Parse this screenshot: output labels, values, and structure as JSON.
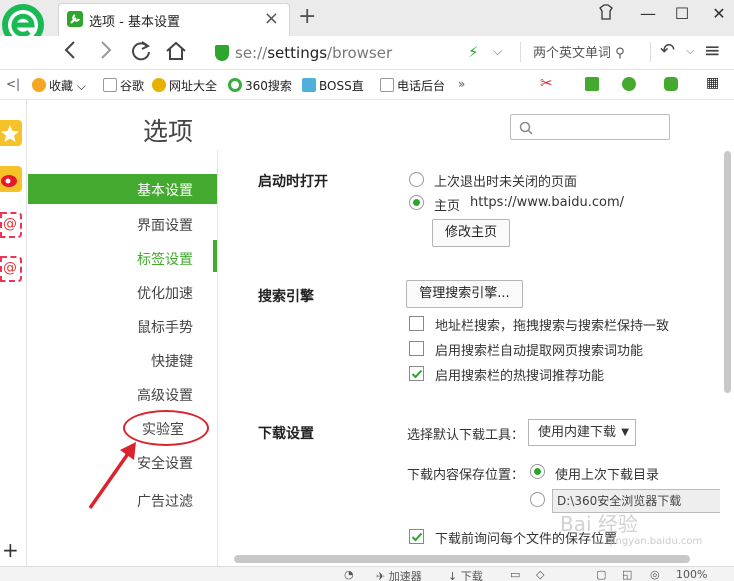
{
  "browser": {
    "tab_title": "选项 - 基本设置",
    "tab_close": "×",
    "new_tab": "+",
    "url_prefix": "se://",
    "url_host": "settings",
    "url_path": "/browser",
    "search_hint": "两个英文单词",
    "window_buttons": [
      "—",
      "☐",
      "✕"
    ]
  },
  "bookmarks": [
    {
      "label": "收藏",
      "color": "#f5a623"
    },
    {
      "label": "谷歌",
      "color": "#9e9e9e"
    },
    {
      "label": "网址大全",
      "color": "#e7b100"
    },
    {
      "label": "360搜索",
      "color": "#3bab3b"
    },
    {
      "label": "BOSS直",
      "color": "#4fb0d9"
    },
    {
      "label": "电话后台",
      "color": "#9e9e9e"
    }
  ],
  "bookmarks_more": "»",
  "settings": {
    "title": "选项",
    "search_placeholder": ""
  },
  "nav": {
    "items": [
      {
        "label": "基本设置",
        "state": "active"
      },
      {
        "label": "界面设置",
        "state": "normal"
      },
      {
        "label": "标签设置",
        "state": "highlight"
      },
      {
        "label": "优化加速",
        "state": "normal"
      },
      {
        "label": "鼠标手势",
        "state": "normal"
      },
      {
        "label": "快捷键",
        "state": "normal"
      },
      {
        "label": "高级设置",
        "state": "normal"
      },
      {
        "label": "实验室",
        "state": "circled"
      },
      {
        "label": "安全设置",
        "state": "normal"
      },
      {
        "label": "广告过滤",
        "state": "normal"
      }
    ]
  },
  "startup": {
    "title": "启动时打开",
    "option_last": "上次退出时未关闭的页面",
    "option_home": "主页",
    "home_url": "https://www.baidu.com/",
    "change_home_button": "修改主页"
  },
  "search_engine": {
    "title": "搜索引擎",
    "manage_button": "管理搜索引擎...",
    "options": [
      {
        "label": "地址栏搜索，拖拽搜索与搜索栏保持一致",
        "checked": false
      },
      {
        "label": "启用搜索栏自动提取网页搜索词功能",
        "checked": false
      },
      {
        "label": "启用搜索栏的热搜词推荐功能",
        "checked": true
      }
    ]
  },
  "download": {
    "title": "下载设置",
    "tool_label": "选择默认下载工具：",
    "tool_value": "使用内建下载",
    "location_label": "下载内容保存位置：",
    "use_last_dir": "使用上次下载目录",
    "path_value": "D:\\360安全浏览器下载",
    "ask_each_file": "下载前询问每个文件的保存位置",
    "ask_checked": true
  },
  "status_bar": {
    "downloader": "加速器",
    "download": "下载",
    "zoom": "100%"
  },
  "watermark": {
    "text": "Bai 经验",
    "sub": "jingyan.baidu.com"
  },
  "colors": {
    "accent": "#43a92f",
    "annotation": "#d9232e"
  }
}
